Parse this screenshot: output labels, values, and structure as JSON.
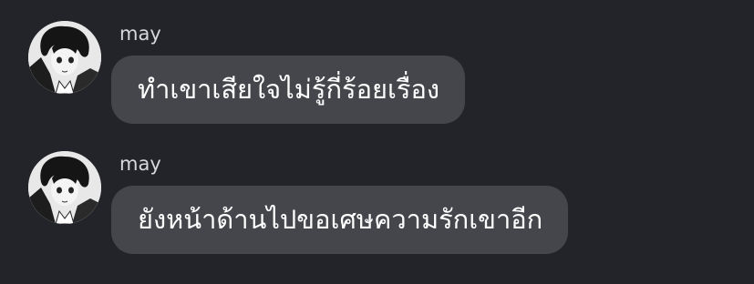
{
  "messages": [
    {
      "sender": "may",
      "text": "ทำเขาเสียใจไม่รู้กี่ร้อยเรื่อง",
      "avatar_icon": "user-avatar-icon"
    },
    {
      "sender": "may",
      "text": "ยังหน้าด้านไปขอเศษความรักเขาอีก",
      "avatar_icon": "user-avatar-icon"
    }
  ],
  "colors": {
    "background": "#232429",
    "bubble": "#44464c",
    "text": "#ffffff",
    "sender": "#d6d7da"
  }
}
